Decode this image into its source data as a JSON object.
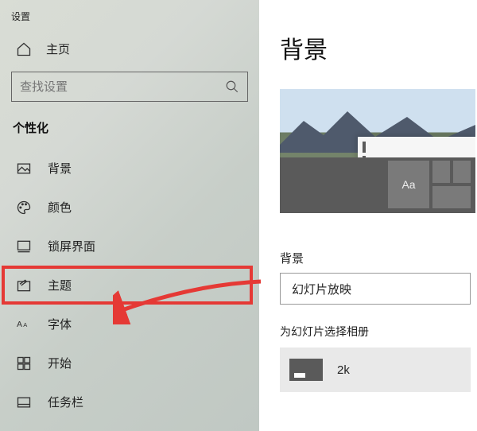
{
  "sidebar": {
    "window_title": "设置",
    "home_label": "主页",
    "search_placeholder": "查找设置",
    "section_label": "个性化",
    "items": [
      {
        "label": "背景"
      },
      {
        "label": "颜色"
      },
      {
        "label": "锁屏界面"
      },
      {
        "label": "主题"
      },
      {
        "label": "字体"
      },
      {
        "label": "开始"
      },
      {
        "label": "任务栏"
      }
    ],
    "highlighted_index": 3
  },
  "main": {
    "title": "背景",
    "preview_sample_text": "Aa",
    "bg_field_label": "背景",
    "bg_select_value": "幻灯片放映",
    "album_label": "为幻灯片选择相册",
    "album_name": "2k"
  }
}
